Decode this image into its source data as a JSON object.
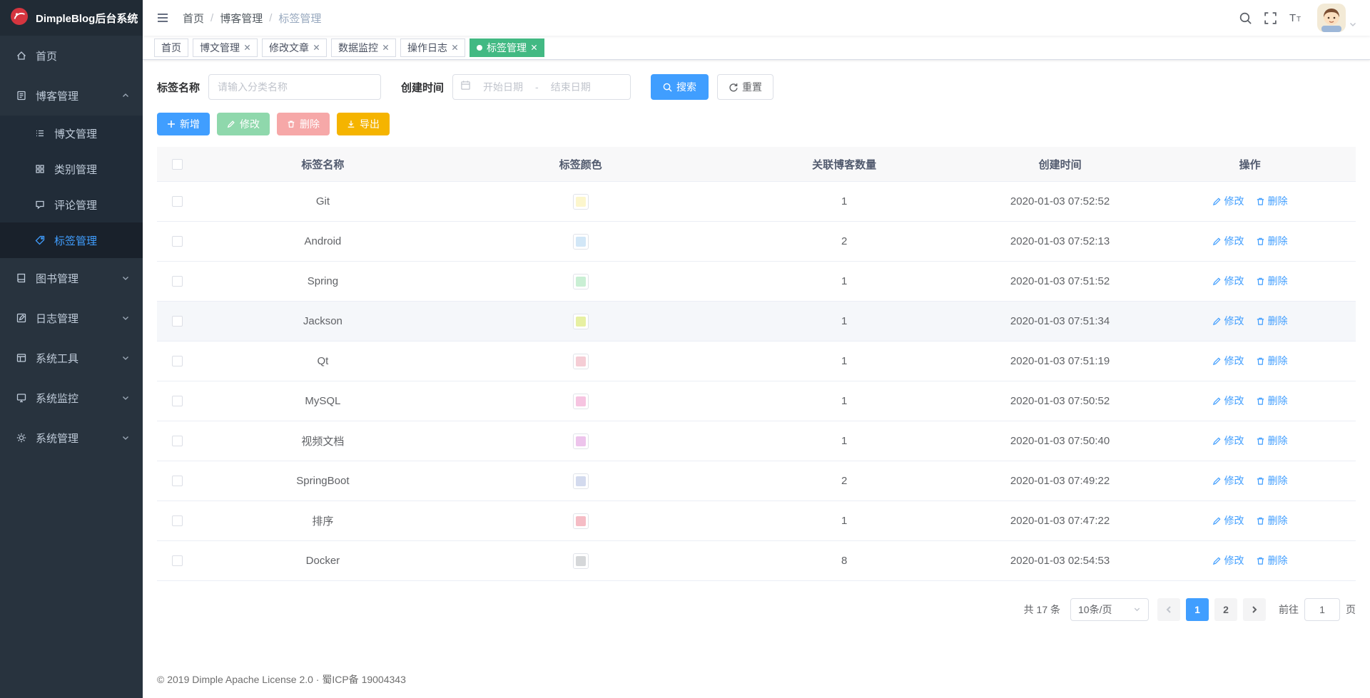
{
  "app": {
    "title": "DimpleBlog后台系统"
  },
  "colors": {
    "accent": "#409eff",
    "tab_active_green": "#42b983",
    "sidebar_bg": "#28333e",
    "export_yellow": "#f5b400",
    "edit_disabled_green": "#8fd8ac",
    "delete_disabled_red": "#f6a8a8"
  },
  "header": {
    "breadcrumb": [
      "首页",
      "博客管理",
      "标签管理"
    ],
    "separator": "/"
  },
  "tabs": [
    {
      "label": "首页",
      "closable": false,
      "active": false
    },
    {
      "label": "博文管理",
      "closable": true,
      "active": false
    },
    {
      "label": "修改文章",
      "closable": true,
      "active": false
    },
    {
      "label": "数据监控",
      "closable": true,
      "active": false
    },
    {
      "label": "操作日志",
      "closable": true,
      "active": false
    },
    {
      "label": "标签管理",
      "closable": true,
      "active": true
    }
  ],
  "sidebar": {
    "items": [
      {
        "label": "首页"
      },
      {
        "label": "博客管理",
        "expanded": true,
        "children": [
          {
            "label": "博文管理"
          },
          {
            "label": "类别管理"
          },
          {
            "label": "评论管理"
          },
          {
            "label": "标签管理",
            "active": true
          }
        ]
      },
      {
        "label": "图书管理"
      },
      {
        "label": "日志管理"
      },
      {
        "label": "系统工具"
      },
      {
        "label": "系统监控"
      },
      {
        "label": "系统管理"
      }
    ]
  },
  "filters": {
    "name_label": "标签名称",
    "name_placeholder": "请输入分类名称",
    "date_label": "创建时间",
    "date_start_placeholder": "开始日期",
    "date_separator": "-",
    "date_end_placeholder": "结束日期",
    "search_label": "搜索",
    "reset_label": "重置"
  },
  "toolbar": {
    "add_label": "新增",
    "edit_label": "修改",
    "delete_label": "删除",
    "export_label": "导出"
  },
  "table": {
    "headers": [
      "标签名称",
      "标签颜色",
      "关联博客数量",
      "创建时间",
      "操作"
    ],
    "op_edit_label": "修改",
    "op_delete_label": "删除",
    "rows": [
      {
        "name": "Git",
        "color": "#fcf6cd",
        "count": "1",
        "created": "2020-01-03 07:52:52"
      },
      {
        "name": "Android",
        "color": "#d2e7f7",
        "count": "2",
        "created": "2020-01-03 07:52:13"
      },
      {
        "name": "Spring",
        "color": "#c9efd4",
        "count": "1",
        "created": "2020-01-03 07:51:52"
      },
      {
        "name": "Jackson",
        "color": "#e7f0a2",
        "count": "1",
        "created": "2020-01-03 07:51:34"
      },
      {
        "name": "Qt",
        "color": "#f5cdd5",
        "count": "1",
        "created": "2020-01-03 07:51:19"
      },
      {
        "name": "MySQL",
        "color": "#f6c4e1",
        "count": "1",
        "created": "2020-01-03 07:50:52"
      },
      {
        "name": "视频文档",
        "color": "#edc4ec",
        "count": "1",
        "created": "2020-01-03 07:50:40"
      },
      {
        "name": "SpringBoot",
        "color": "#d3daee",
        "count": "2",
        "created": "2020-01-03 07:49:22"
      },
      {
        "name": "排序",
        "color": "#f5bcc5",
        "count": "1",
        "created": "2020-01-03 07:47:22"
      },
      {
        "name": "Docker",
        "color": "#d5d7d9",
        "count": "8",
        "created": "2020-01-03 02:54:53"
      }
    ]
  },
  "pagination": {
    "total": "共 17 条",
    "page_size": "10条/页",
    "pages": [
      "1",
      "2"
    ],
    "current_page": "1",
    "goto_label": "前往",
    "goto_value": "1",
    "unit_label": "页"
  },
  "footer": {
    "text": "© 2019 Dimple Apache License 2.0 · 蜀ICP备 19004343"
  }
}
